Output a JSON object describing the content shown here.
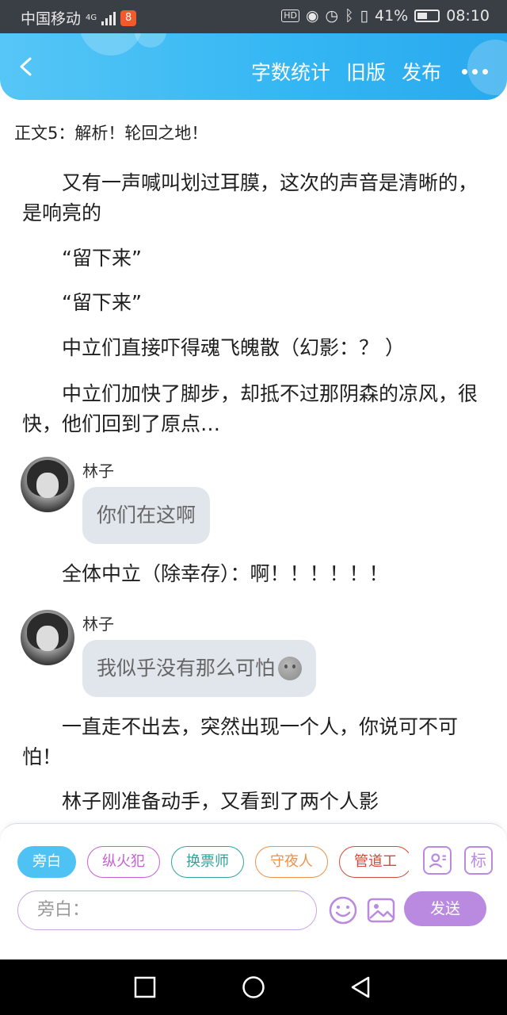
{
  "status_bar": {
    "carrier": "中国移动",
    "network": "4G",
    "app_badge": "8",
    "hd": "HD",
    "battery": "41%",
    "time": "08:10"
  },
  "header": {
    "back_icon": "chevron-left-icon",
    "actions": [
      "字数统计",
      "旧版",
      "发布"
    ],
    "more_icon": "more-dots-icon",
    "accent": "#33b6f3"
  },
  "content": {
    "chapter_title": "正文5：解析！轮回之地！",
    "paragraphs": [
      "又有一声喊叫划过耳膜，这次的声音是清晰的，是响亮的",
      "“留下来”",
      "“留下来”",
      "中立们直接吓得魂飞魄散（幻影：？ ）",
      "中立们加快了脚步，却抵不过那阴森的凉风，很快，他们回到了原点…",
      "全体中立（除幸存）：啊！！！！！！",
      "一直走不出去，突然出现一个人，你说可不可怕！",
      "林子刚准备动手，又看到了两个人影"
    ],
    "messages": [
      {
        "name": "林子",
        "text": "你们在这啊"
      },
      {
        "name": "林子",
        "text": "我似乎没有那么可怕"
      }
    ]
  },
  "composer": {
    "roles": [
      "旁白",
      "纵火犯",
      "换票师",
      "守夜人",
      "管道工"
    ],
    "active_role": "旁白",
    "role_colors": [
      "#4dc2f3",
      "#c95fd6",
      "#2fa49b",
      "#ef9147",
      "#d24b35"
    ],
    "tool_icons": [
      "contact-card-icon",
      "tag-icon"
    ],
    "tag_label": "标",
    "input_placeholder": "旁白：",
    "emoji_icon": "smiley-icon",
    "image_icon": "image-icon",
    "send_label": "发送",
    "send_color": "#b98ae0"
  },
  "system_nav": [
    "square-icon",
    "circle-icon",
    "triangle-back-icon"
  ]
}
